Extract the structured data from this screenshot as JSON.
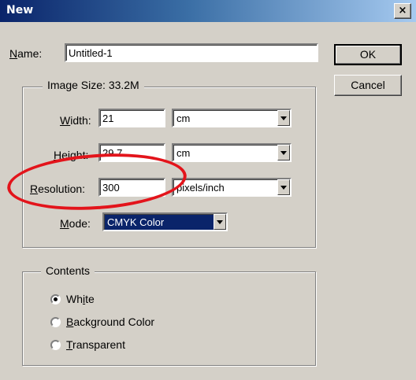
{
  "dialog": {
    "title": "New",
    "close_glyph": "×"
  },
  "name": {
    "label": "Name:",
    "mnemonic": "N",
    "rest": "ame:",
    "value": "Untitled-1"
  },
  "buttons": {
    "ok": "OK",
    "cancel": "Cancel"
  },
  "image_size": {
    "title": "Image Size: 33.2M",
    "width": {
      "mnemonic": "W",
      "rest": "idth:",
      "value": "21",
      "unit": "cm"
    },
    "height": {
      "mnemonic": "H",
      "rest": "eight:",
      "value": "29.7",
      "unit": "cm"
    },
    "resolution": {
      "mnemonic": "R",
      "rest": "esolution:",
      "value": "300",
      "unit": "pixels/inch"
    },
    "mode": {
      "mnemonic": "M",
      "rest": "ode:",
      "value": "CMYK Color"
    }
  },
  "contents": {
    "title": "Contents",
    "options": [
      {
        "pre": "Wh",
        "mnemonic": "i",
        "rest": "te",
        "checked": true
      },
      {
        "pre": "",
        "mnemonic": "B",
        "rest": "ackground Color",
        "checked": false
      },
      {
        "pre": "",
        "mnemonic": "T",
        "rest": "ransparent",
        "checked": false
      }
    ]
  },
  "annotation": {
    "color": "#e3141b",
    "shape": "ellipse around Resolution field"
  },
  "colors": {
    "titlebar_start": "#0a246a",
    "titlebar_end": "#a6caf0",
    "face": "#d4d0c8"
  }
}
